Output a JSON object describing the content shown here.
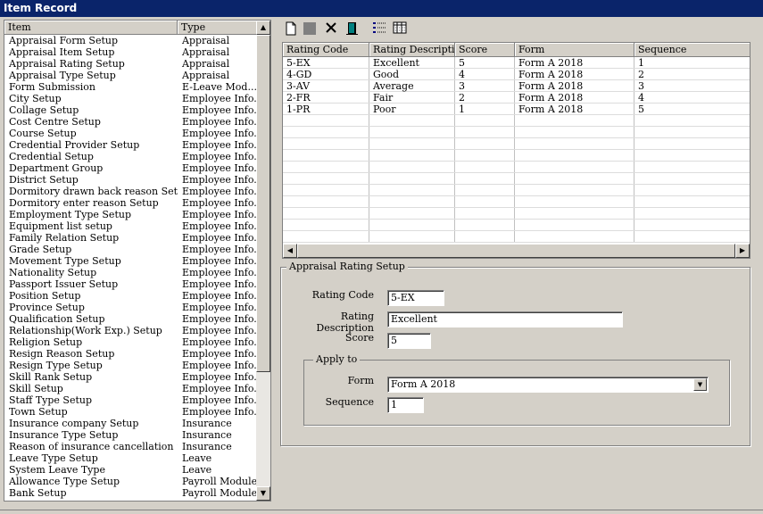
{
  "window": {
    "title": "Item Record"
  },
  "item_list": {
    "columns": [
      "Item",
      "Type"
    ],
    "rows": [
      [
        "Appraisal Form Setup",
        "Appraisal"
      ],
      [
        "Appraisal Item Setup",
        "Appraisal"
      ],
      [
        "Appraisal Rating Setup",
        "Appraisal"
      ],
      [
        "Appraisal Type Setup",
        "Appraisal"
      ],
      [
        "Form Submission",
        "E-Leave Mod..."
      ],
      [
        "City Setup",
        "Employee Info."
      ],
      [
        "Collage Setup",
        "Employee Info."
      ],
      [
        "Cost Centre Setup",
        "Employee Info."
      ],
      [
        "Course Setup",
        "Employee Info."
      ],
      [
        "Credential Provider Setup",
        "Employee Info."
      ],
      [
        "Credential Setup",
        "Employee Info."
      ],
      [
        "Department Group",
        "Employee Info."
      ],
      [
        "District Setup",
        "Employee Info."
      ],
      [
        "Dormitory drawn back reason Setup",
        "Employee Info."
      ],
      [
        "Dormitory enter reason Setup",
        "Employee Info."
      ],
      [
        "Employment Type Setup",
        "Employee Info."
      ],
      [
        "Equipment list setup",
        "Employee Info."
      ],
      [
        "Family Relation Setup",
        "Employee Info."
      ],
      [
        "Grade Setup",
        "Employee Info."
      ],
      [
        "Movement Type Setup",
        "Employee Info."
      ],
      [
        "Nationality Setup",
        "Employee Info."
      ],
      [
        "Passport Issuer Setup",
        "Employee Info."
      ],
      [
        "Position Setup",
        "Employee Info."
      ],
      [
        "Province Setup",
        "Employee Info."
      ],
      [
        "Qualification Setup",
        "Employee Info."
      ],
      [
        "Relationship(Work Exp.) Setup",
        "Employee Info."
      ],
      [
        "Religion Setup",
        "Employee Info."
      ],
      [
        "Resign Reason Setup",
        "Employee Info."
      ],
      [
        "Resign Type Setup",
        "Employee Info."
      ],
      [
        "Skill Rank Setup",
        "Employee Info."
      ],
      [
        "Skill Setup",
        "Employee Info."
      ],
      [
        "Staff Type Setup",
        "Employee Info."
      ],
      [
        "Town Setup",
        "Employee Info."
      ],
      [
        "Insurance company Setup",
        "Insurance"
      ],
      [
        "Insurance Type Setup",
        "Insurance"
      ],
      [
        "Reason of insurance cancellation Setup",
        "Insurance"
      ],
      [
        "Leave Type Setup",
        "Leave"
      ],
      [
        "System Leave Type",
        "Leave"
      ],
      [
        "Allowance Type Setup",
        "Payroll Module"
      ],
      [
        "Bank Setup",
        "Payroll Module"
      ]
    ]
  },
  "toolbar": {
    "icons": [
      "new-icon",
      "save-icon",
      "delete-icon",
      "exit-icon",
      "list-view-icon",
      "detail-view-icon"
    ]
  },
  "rating_grid": {
    "columns": [
      "Rating Code",
      "Rating Descripti...",
      "Score",
      "Form",
      "Sequence"
    ],
    "rows": [
      [
        "5-EX",
        "Excellent",
        "5",
        "Form A 2018",
        "1"
      ],
      [
        "4-GD",
        "Good",
        "4",
        "Form A 2018",
        "2"
      ],
      [
        "3-AV",
        "Average",
        "3",
        "Form A 2018",
        "3"
      ],
      [
        "2-FR",
        "Fair",
        "2",
        "Form A 2018",
        "4"
      ],
      [
        "1-PR",
        "Poor",
        "1",
        "Form A 2018",
        "5"
      ]
    ]
  },
  "form": {
    "group_title": "Appraisal Rating Setup",
    "rating_code_label": "Rating Code",
    "rating_code_value": "5-EX",
    "rating_description_label": "Rating Description",
    "rating_description_value": "Excellent",
    "score_label": "Score",
    "score_value": "5",
    "apply_to_title": "Apply to",
    "form_label": "Form",
    "form_value": "Form A 2018",
    "sequence_label": "Sequence",
    "sequence_value": "1"
  }
}
